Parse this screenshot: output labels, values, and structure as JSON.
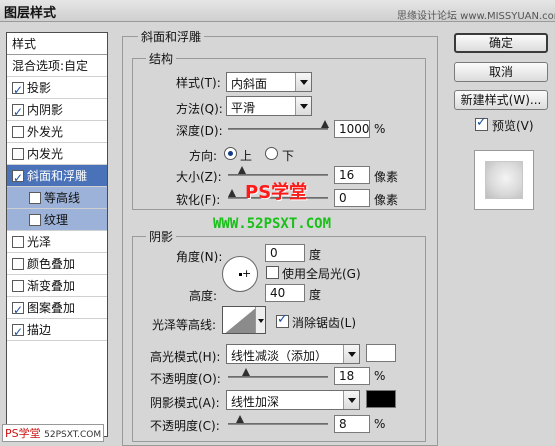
{
  "window": {
    "title": "图层样式",
    "watermark": "思缘设计论坛 www.MISSYUAN.com"
  },
  "styles_list": {
    "header": "样式",
    "blend_options": "混合选项:自定",
    "items": [
      {
        "label": "投影",
        "checked": true
      },
      {
        "label": "内阴影",
        "checked": true
      },
      {
        "label": "外发光",
        "checked": false
      },
      {
        "label": "内发光",
        "checked": false
      },
      {
        "label": "斜面和浮雕",
        "checked": true,
        "selected": true
      },
      {
        "label": "等高线",
        "checked": false,
        "sub": true
      },
      {
        "label": "纹理",
        "checked": false,
        "sub": true
      },
      {
        "label": "光泽",
        "checked": false
      },
      {
        "label": "颜色叠加",
        "checked": false
      },
      {
        "label": "渐变叠加",
        "checked": false
      },
      {
        "label": "图案叠加",
        "checked": true
      },
      {
        "label": "描边",
        "checked": true
      }
    ]
  },
  "buttons": {
    "ok": "确定",
    "cancel": "取消",
    "new_style": "新建样式(W)...",
    "preview": "预览(V)"
  },
  "bevel": {
    "title": "斜面和浮雕",
    "structure": {
      "title": "结构",
      "style_label": "样式(T):",
      "style_value": "内斜面",
      "technique_label": "方法(Q):",
      "technique_value": "平滑",
      "depth_label": "深度(D):",
      "depth_value": "1000",
      "depth_unit": "%",
      "direction_label": "方向:",
      "dir_up": "上",
      "dir_down": "下",
      "size_label": "大小(Z):",
      "size_value": "16",
      "size_unit": "像素",
      "soften_label": "软化(F):",
      "soften_value": "0",
      "soften_unit": "像素"
    },
    "shading": {
      "title": "阴影",
      "angle_label": "角度(N):",
      "angle_value": "0",
      "angle_unit": "度",
      "global_light": "使用全局光(G)",
      "altitude_label": "高度:",
      "altitude_value": "40",
      "altitude_unit": "度",
      "gloss_label": "光泽等高线:",
      "antialias": "消除锯齿(L)",
      "highlight_label": "高光模式(H):",
      "highlight_value": "线性减淡（添加）",
      "highlight_opacity_label": "不透明度(O):",
      "highlight_opacity_value": "18",
      "opacity_unit": "%",
      "shadow_label": "阴影模式(A):",
      "shadow_value": "线性加深",
      "shadow_opacity_label": "不透明度(C):",
      "shadow_opacity_value": "8"
    }
  },
  "overlays": {
    "ps": "PS学堂",
    "url": "WWW.52PSXT.COM",
    "bottom_ps": "PS学堂",
    "bottom_url": "52PSXT.COM"
  },
  "colors": {
    "selected_row": "#4a72b8",
    "sub_row": "#9cb2d8",
    "highlight_swatch": "#ffffff",
    "shadow_swatch": "#000000"
  }
}
